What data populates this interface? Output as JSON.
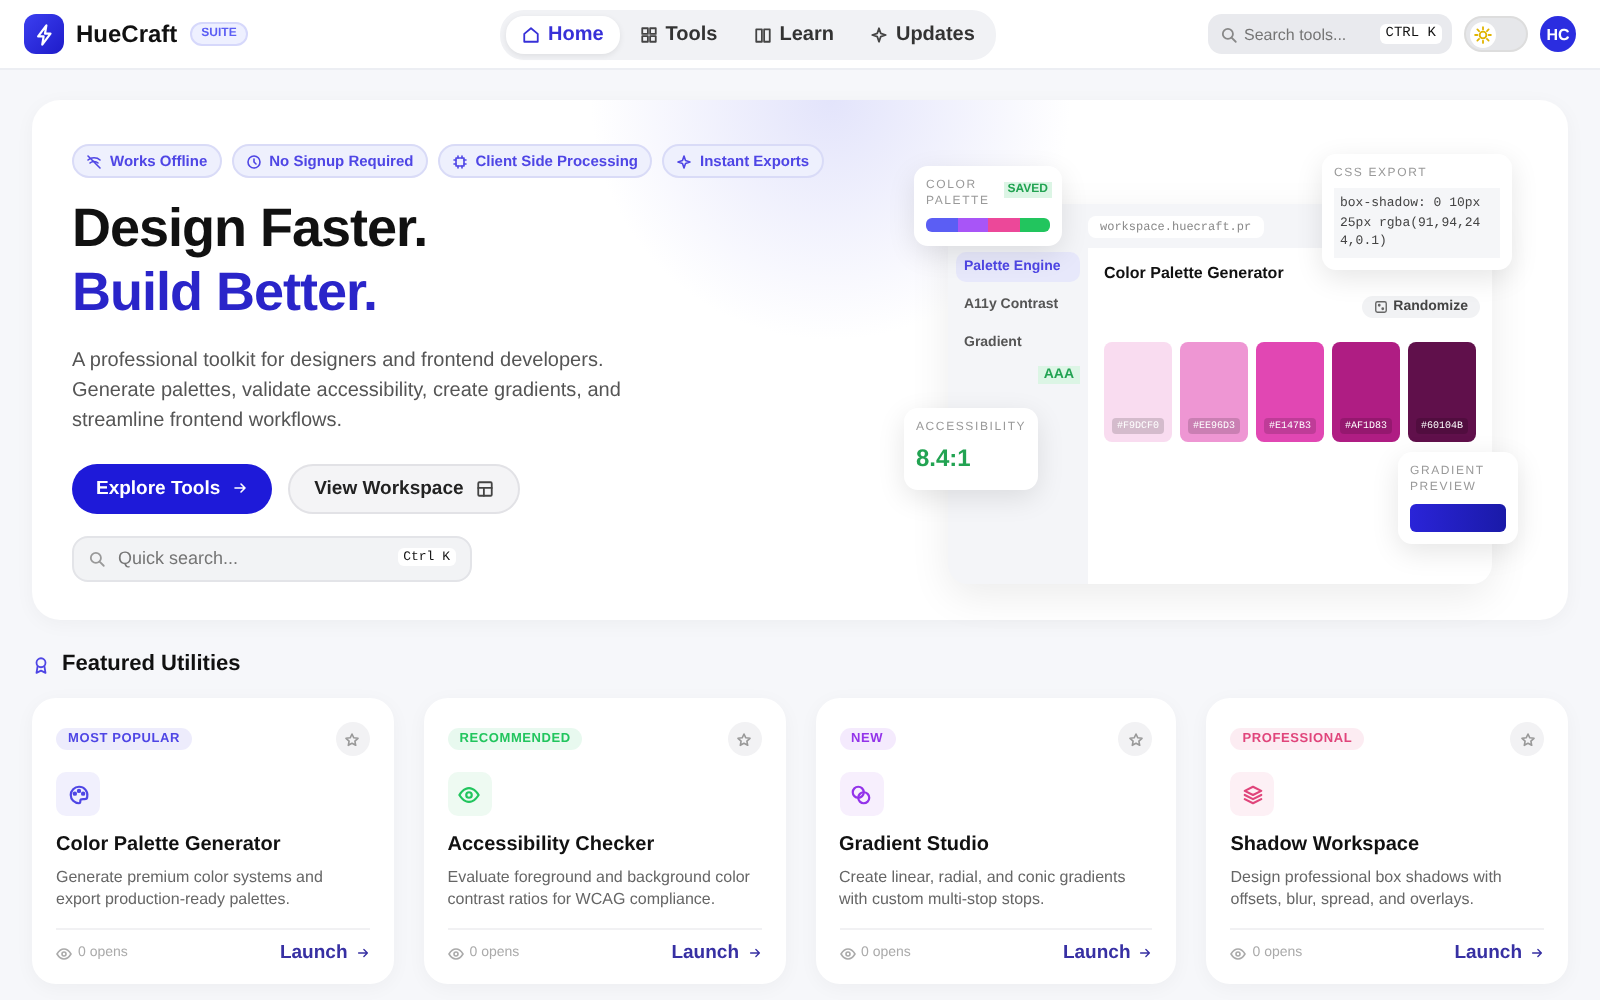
{
  "header": {
    "logo": "HueCraft",
    "badge": "SUITE",
    "nav": [
      {
        "label": "Home",
        "selected": true
      },
      {
        "label": "Tools",
        "selected": false
      },
      {
        "label": "Learn",
        "selected": false
      },
      {
        "label": "Updates",
        "selected": false
      }
    ],
    "search": {
      "placeholder": "Search tools...",
      "shortcut": "CTRL K"
    },
    "theme_toggle": {
      "on": false
    },
    "avatar": "HC"
  },
  "hero": {
    "features": [
      {
        "label": "Works Offline"
      },
      {
        "label": "No Signup Required"
      },
      {
        "label": "Client Side Processing"
      },
      {
        "label": "Instant Exports"
      }
    ],
    "title": "Design Faster.",
    "title_accent": "Build Better.",
    "description": "A professional toolkit for designers and frontend developers. Generate palettes, validate accessibility, create gradients, and streamline frontend workflows.",
    "primary_button": "Explore Tools",
    "secondary_button": "View Workspace",
    "quick_search": {
      "placeholder": "Quick search...",
      "shortcut": "Ctrl K"
    },
    "preview": {
      "address": "workspace.huecraft.pr",
      "sidebar": [
        {
          "label": "Palette Engine",
          "selected": true
        },
        {
          "label": "A11y Contrast",
          "selected": false
        },
        {
          "label": "Gradient",
          "selected": false
        }
      ],
      "badge": "AAA",
      "panel_title": "Color Palette Generator",
      "randomize": "Randomize",
      "swatches": [
        {
          "label": "#F9DCF0",
          "color": "#f9dcf0"
        },
        {
          "label": "#EE96D3",
          "color": "#ee96d3"
        },
        {
          "label": "#E147B3",
          "color": "#e147b3"
        },
        {
          "label": "#AF1D83",
          "color": "#af1d83"
        },
        {
          "label": "#60104B",
          "color": "#60104b"
        }
      ],
      "palette_card": {
        "title": "COLOR PALETTE",
        "status": "SAVED"
      },
      "css_card": {
        "title": "CSS EXPORT",
        "code": "box-shadow: 0 10px 25px rgba(91,94,244,0.1)"
      },
      "accessibility_card": {
        "title": "ACCESSIBILITY",
        "value": "8.4:1"
      },
      "gradient_card": {
        "title": "GRADIENT PREVIEW"
      }
    }
  },
  "featured": {
    "title": "Featured Utilities",
    "cards": [
      {
        "tag": "MOST POPULAR",
        "color": "#4f46e5",
        "title": "Color Palette Generator",
        "description": "Generate premium color systems and export production-ready palettes.",
        "opens": "0 opens",
        "action": "Launch"
      },
      {
        "tag": "RECOMMENDED",
        "color": "#22c55e",
        "title": "Accessibility Checker",
        "description": "Evaluate foreground and background color contrast ratios for WCAG compliance.",
        "opens": "0 opens",
        "action": "Launch"
      },
      {
        "tag": "NEW",
        "color": "#9333ea",
        "title": "Gradient Studio",
        "description": "Create linear, radial, and conic gradients with custom multi-stop stops.",
        "opens": "0 opens",
        "action": "Launch"
      },
      {
        "tag": "PROFESSIONAL",
        "color": "#e0457b",
        "title": "Shadow Workspace",
        "description": "Design professional box shadows with offsets, blur, spread, and overlays.",
        "opens": "0 opens",
        "action": "Launch"
      }
    ]
  }
}
